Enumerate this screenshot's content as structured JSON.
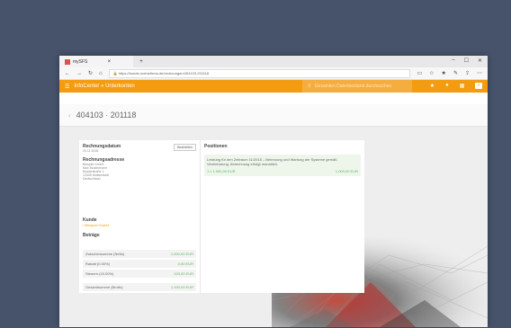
{
  "browser": {
    "tab_title": "mySFS",
    "url": "https://kunde-meinefirma.de/rechnungen/404103-201118",
    "window_controls": [
      "–",
      "☐",
      "✕"
    ]
  },
  "app": {
    "title": "InfoCenter » Unterkonten",
    "search_placeholder": "Gesamten Datenbestand durchsuchen",
    "badge": "IT"
  },
  "page": {
    "heading": "404103 · 201118"
  },
  "left_card": {
    "rechnungsdatum_label": "Rechnungsdatum",
    "rechnungsdatum_value": "20.11.2018",
    "edit_button": "Bearbeiten",
    "address_label": "Rechnungsadresse",
    "address_lines": [
      "Beispiel GmbH",
      "Max Mustermann",
      "Musterstraße 1",
      "12345 Musterstadt",
      "Deutschland"
    ],
    "kunde_label": "Kunde",
    "kunde_value": "Beispiel GmbH",
    "betraege_label": "Beträge",
    "sums": [
      {
        "label": "Zwischensumme (Netto)",
        "value": "1.000,00 EUR"
      },
      {
        "label": "Rabatt (0.00%)",
        "value": "0,00 EUR"
      },
      {
        "label": "Steuern (19.00%)",
        "value": "190,00 EUR"
      },
      {
        "label": "Gesamtsumme (Brutto)",
        "value": "1.190,00 EUR"
      }
    ]
  },
  "right_card": {
    "title": "Positionen",
    "position_text": "Leistung für den Zeitraum 11/2018 – Betreuung und Wartung der Systeme gemäß Vereinbarung. Abrechnung erfolgt monatlich.",
    "quantity": "1 x 1.000,00 EUR",
    "amount": "1.000,00 EUR"
  }
}
